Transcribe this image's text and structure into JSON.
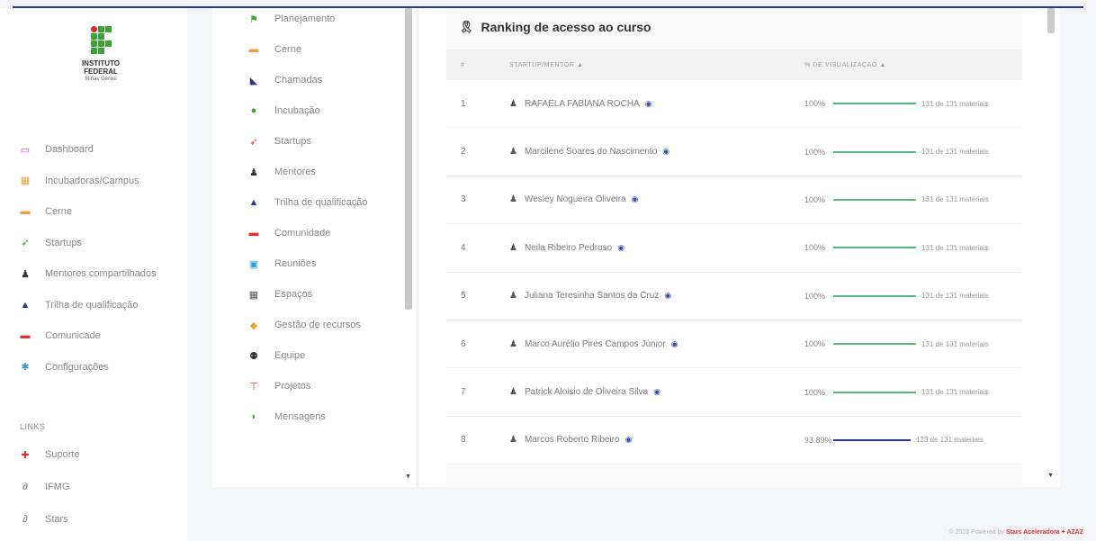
{
  "logo": {
    "line1": "INSTITUTO",
    "line2": "FEDERAL",
    "line3": "Minas Gerais"
  },
  "sidebar": {
    "items": [
      {
        "label": "Dashboard",
        "icon": "monitor-icon",
        "color": "#9b59b6"
      },
      {
        "label": "Incubadoras/Campus",
        "icon": "building-icon",
        "color": "#e8a23a"
      },
      {
        "label": "Cerne",
        "icon": "book-icon",
        "color": "#e8a23a"
      },
      {
        "label": "Startups",
        "icon": "rocket-icon",
        "color": "#3aa335"
      },
      {
        "label": "Mentores compartilhados",
        "icon": "user-icon",
        "color": "#333333"
      },
      {
        "label": "Trilha de qualificação",
        "icon": "graduation-cap-icon",
        "color": "#2b3a8f"
      },
      {
        "label": "Comunicade",
        "icon": "chat-icon",
        "color": "#e0322d"
      },
      {
        "label": "Configurações",
        "icon": "gear-icon",
        "color": "#2b9cd8"
      }
    ],
    "links_title": "LINKS",
    "links": [
      {
        "label": "Suporte",
        "icon": "lifebuoy-icon",
        "color": "#e0322d"
      },
      {
        "label": "IFMG",
        "icon": "link-icon",
        "color": "#777777"
      },
      {
        "label": "Stars",
        "icon": "link-icon",
        "color": "#777777"
      }
    ]
  },
  "menu2": {
    "items": [
      {
        "label": "Planejamento",
        "icon": "flag-icon",
        "color": "#3aa335"
      },
      {
        "label": "Cerne",
        "icon": "book-icon",
        "color": "#e8a23a"
      },
      {
        "label": "Chamadas",
        "icon": "megaphone-icon",
        "color": "#2b3a8f"
      },
      {
        "label": "Incubação",
        "icon": "egg-icon",
        "color": "#3aa335"
      },
      {
        "label": "Startups",
        "icon": "rocket-icon",
        "color": "#e0322d"
      },
      {
        "label": "Mentores",
        "icon": "user-icon",
        "color": "#333333"
      },
      {
        "label": "Trilha de qualificação",
        "icon": "graduation-cap-icon",
        "color": "#2b3a8f"
      },
      {
        "label": "Comunidade",
        "icon": "chat-icon",
        "color": "#e0322d"
      },
      {
        "label": "Reuniões",
        "icon": "meeting-icon",
        "color": "#2b9cd8"
      },
      {
        "label": "Espaços",
        "icon": "building-icon",
        "color": "#555555"
      },
      {
        "label": "Gestão de recursos",
        "icon": "coins-icon",
        "color": "#e8a23a"
      },
      {
        "label": "Equipe",
        "icon": "team-icon",
        "color": "#333333"
      },
      {
        "label": "Projetos",
        "icon": "sitemap-icon",
        "color": "#e0322d"
      },
      {
        "label": "Mensagens",
        "icon": "messages-icon",
        "color": "#3aa335"
      }
    ]
  },
  "ranking": {
    "title": "Ranking de acesso ao curso",
    "columns": {
      "num": "#",
      "name": "STARTUP/MENTOR ▲",
      "vis": "% DE VISUALIZAÇÃO ▲"
    },
    "rows": [
      {
        "num": "1",
        "name": "RAFAELA FABIANA ROCHA",
        "pct": "100%",
        "count": "131 de 131 materiais",
        "progress": 1.0,
        "bar": "green"
      },
      {
        "num": "2",
        "name": "Marcilene Soares do Nascimento",
        "pct": "100%",
        "count": "131 de 131 materiais",
        "progress": 1.0,
        "bar": "green"
      },
      {
        "num": "3",
        "name": "Wesley Nogueira Oliveira",
        "pct": "100%",
        "count": "131 de 131 materiais",
        "progress": 1.0,
        "bar": "green"
      },
      {
        "num": "4",
        "name": "Neila Ribeiro Pedroso",
        "pct": "100%",
        "count": "131 de 131 materiais",
        "progress": 1.0,
        "bar": "green"
      },
      {
        "num": "5",
        "name": "Juliana Teresinha Santos da Cruz",
        "pct": "100%",
        "count": "131 de 131 materiais",
        "progress": 1.0,
        "bar": "green"
      },
      {
        "num": "6",
        "name": "Marco Aurélio Pires Campos Júnior",
        "pct": "100%",
        "count": "131 de 131 materiais",
        "progress": 1.0,
        "bar": "green"
      },
      {
        "num": "7",
        "name": "Patrick Aloisio de Oliveira Silva",
        "pct": "100%",
        "count": "131 de 131 materiais",
        "progress": 1.0,
        "bar": "green"
      },
      {
        "num": "8",
        "name": "Marcos Roberto Ribeiro",
        "pct": "93.89%",
        "count": "123 de 131 materiais",
        "progress": 0.9389,
        "bar": "blue"
      }
    ]
  },
  "footer": {
    "text": "© 2023 Powered by ",
    "brand": "Stars Aceleradora + AZAZ"
  }
}
